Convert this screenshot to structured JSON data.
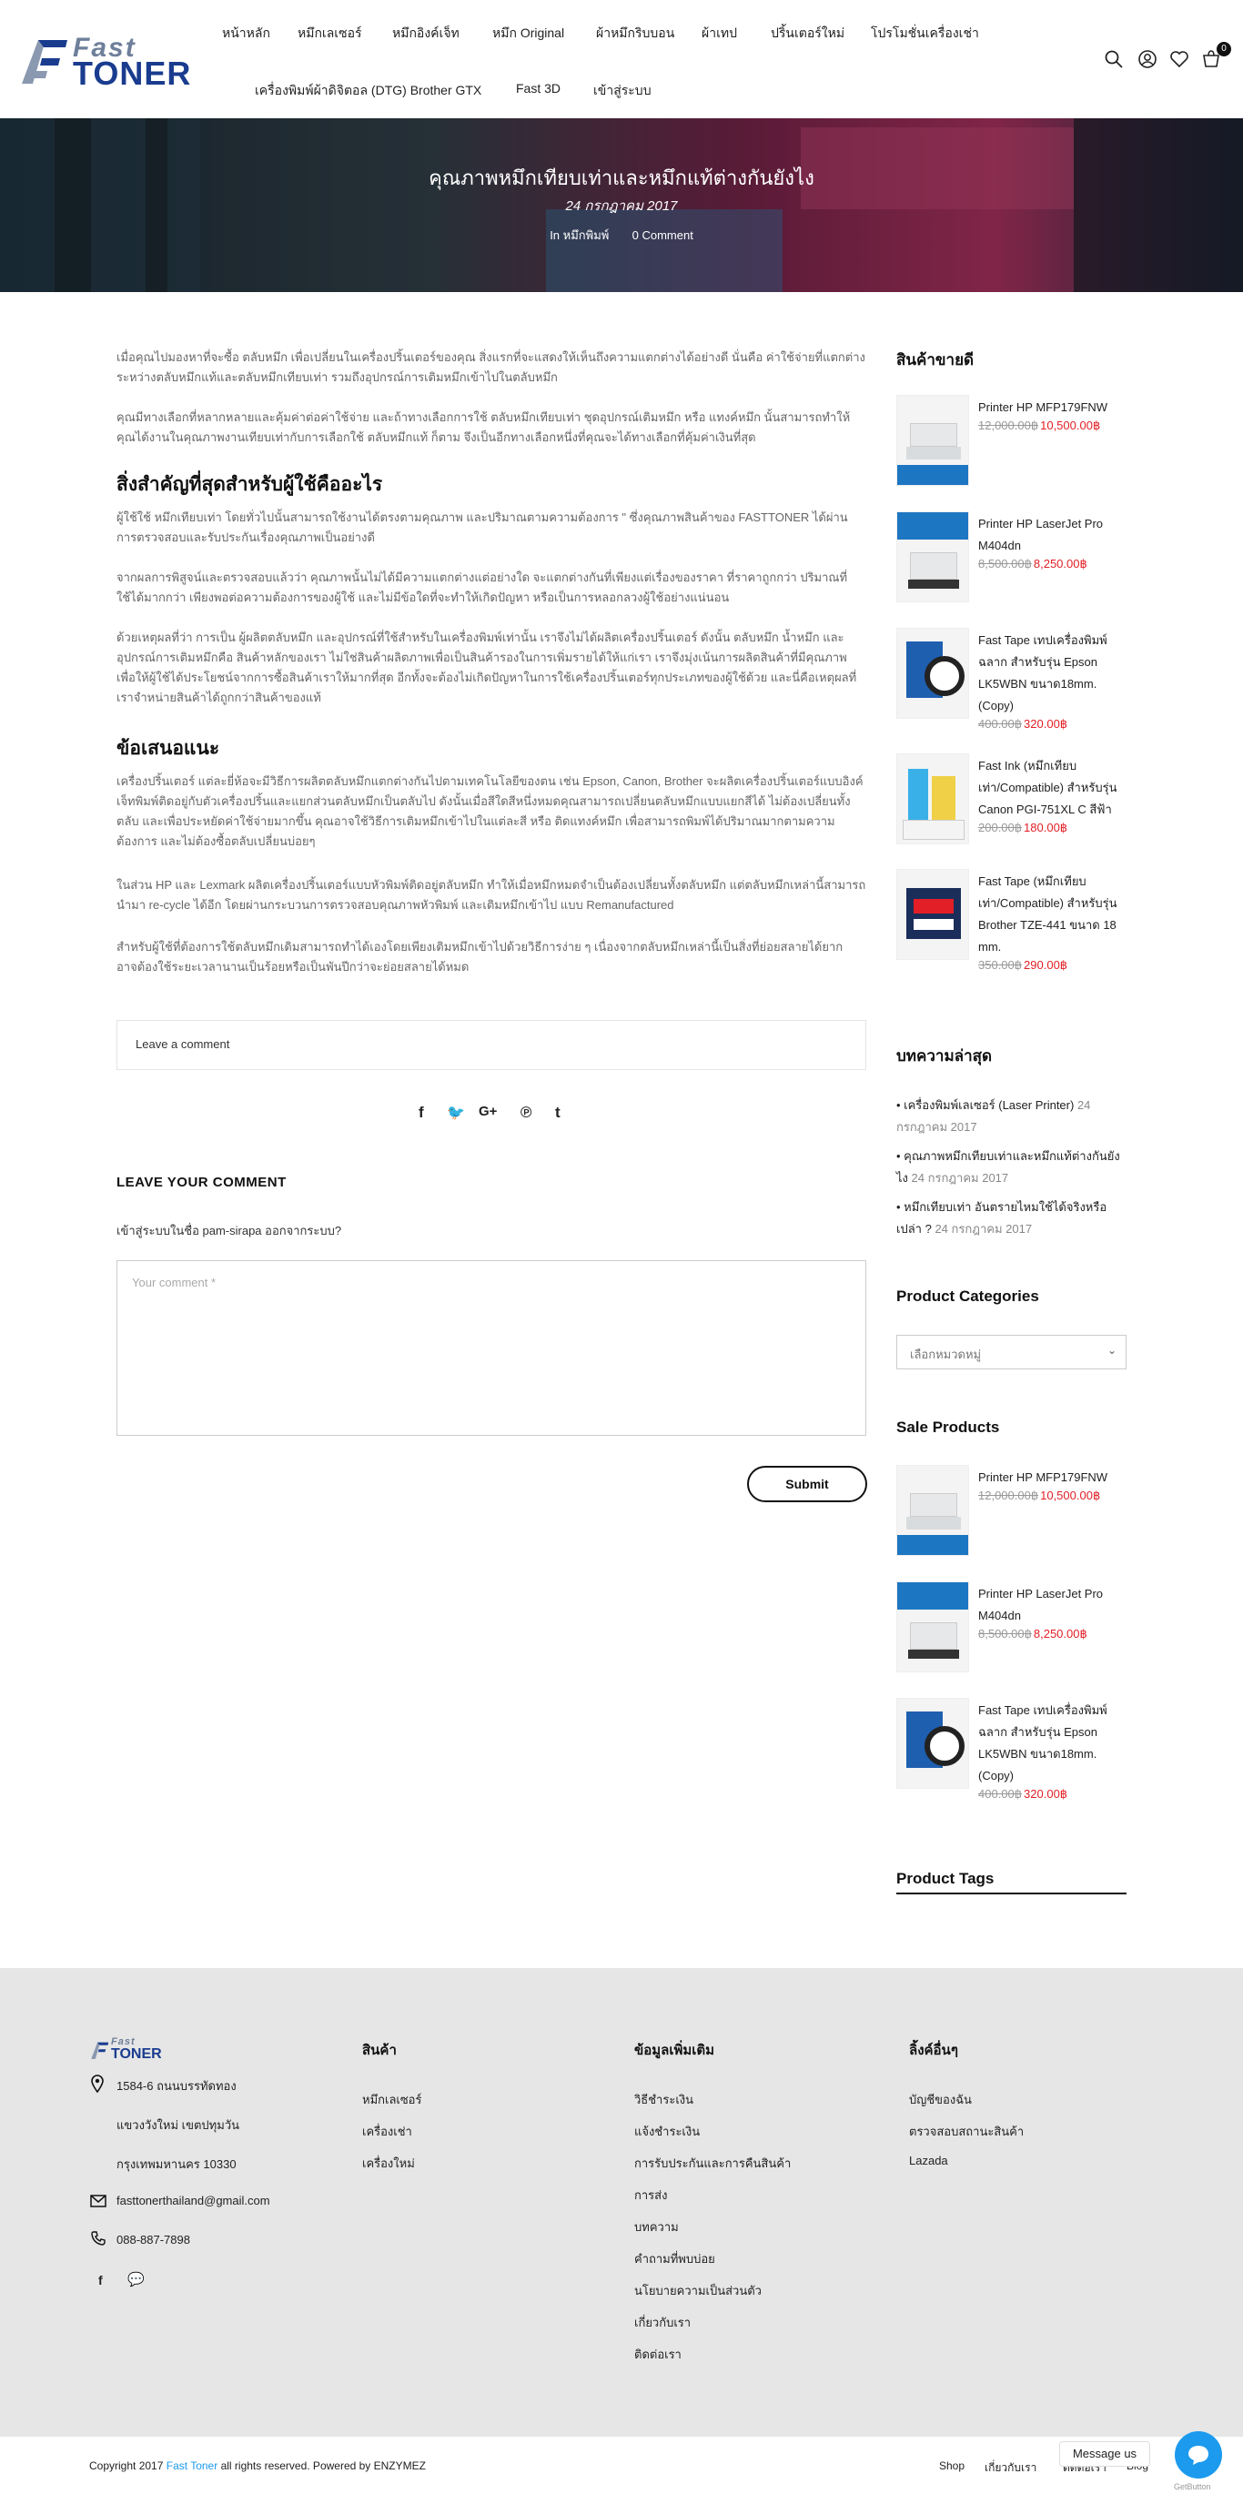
{
  "header": {
    "logo_fast": "Fast",
    "logo_toner": "TONER",
    "nav_row1": [
      "หน้าหลัก",
      "หมึกเลเซอร์",
      "หมึกอิงค์เจ็ท",
      "หมึก Original",
      "ผ้าหมึกริบบอน",
      "ผ้าเทป",
      "ปริ้นเตอร์ใหม่",
      "โปรโมชั่นเครื่องเช่า"
    ],
    "nav_row2": [
      "เครื่องพิมพ์ผ้าดิจิตอล (DTG) Brother GTX",
      "Fast 3D",
      "เข้าสู่ระบบ"
    ],
    "cart_count": "0",
    "icons": [
      "search-icon",
      "user-icon",
      "heart-icon",
      "cart-icon"
    ]
  },
  "banner": {
    "title": "คุณภาพหมึกเทียบเท่าและหมึกแท้ต่างกันยังไง",
    "date": "24 กรกฎาคม 2017",
    "category": "In หมึกพิมพ์",
    "comments": "0 Comment"
  },
  "article": {
    "p1": "เมื่อคุณไปมองหาที่จะซื้อ ตลับหมึก เพื่อเปลี่ยนในเครื่องปริ้นเตอร์ของคุณ สิ่งแรกที่จะแสดงให้เห็นถึงความแตกต่างได้อย่างดี นั่นคือ ค่าใช้จ่ายที่แตกต่างระหว่างตลับหมึกแท้และตลับหมึกเทียบเท่า รวมถึงอุปกรณ์การเติมหมึกเข้าไปในตลับหมึก",
    "p2": "คุณมีทางเลือกที่หลากหลายและคุ้มค่าต่อค่าใช้จ่าย และถ้าทางเลือกการใช้ ตลับหมึกเทียบเท่า ชุดอุปกรณ์เติมหมึก หรือ แทงค์หมึก นั้นสามารถทำให้คุณได้งานในคุณภาพงานเทียบเท่ากับการเลือกใช้ ตลับหมึกแท้ ก็ตาม จึงเป็นอีกทางเลือกหนึ่งที่คุณจะได้ทางเลือกที่คุ้มค่าเงินที่สุด",
    "h1": "สิ่งสำคัญที่สุดสำหรับผู้ใช้คืออะไร",
    "p3": "ผู้ใช้ใช้ หมึกเทียบเท่า โดยทั่วไปนั้นสามารถใช้งานได้ตรงตามคุณภาพ และปริมาณตามความต้องการ \" ซึ่งคุณภาพสินค้าของ FASTTONER ได้ผ่านการตรวจสอบและรับประกันเรื่องคุณภาพเป็นอย่างดี",
    "p4": "จากผลการพิสูจน์และตรวจสอบแล้วว่า คุณภาพนั้นไม่ได้มีความแตกต่างแต่อย่างใด จะแตกต่างกันที่เพียงแต่เรื่องของราคา ที่ราคาถูกกว่า ปริมาณที่ใช้ได้มากกว่า เพียงพอต่อความต้องการของผู้ใช้ และไม่มีข้อใดที่จะทำให้เกิดปัญหา หรือเป็นการหลอกลวงผู้ใช้อย่างแน่นอน",
    "p5": "ด้วยเหตุผลที่ว่า การเป็น ผู้ผลิตตลับหมึก และอุปกรณ์ที่ใช้สำหรับในเครื่องพิมพ์เท่านั้น เราจึงไม่ได้ผลิตเครื่องปริ้นเตอร์ ดังนั้น ตลับหมึก น้ำหมึก และอุปกรณ์การเติมหมึกคือ สินค้าหลักของเรา ไม่ใช่สินค้าผลิตภาพเพื่อเป็นสินค้ารองในการเพิ่มรายได้ให้แก่เรา เราจึงมุ่งเน้นการผลิตสินค้าที่มีคุณภาพ เพื่อให้ผู้ใช้ได้ประโยชน์จากการซื้อสินค้าเราให้มากที่สุด อีกทั้งจะต้องไม่เกิดปัญหาในการใช้เครื่องปริ้นเตอร์ทุกประเภทของผู้ใช้ด้วย และนี่คือเหตุผลที่เราจำหน่ายสินค้าได้ถูกกว่าสินค้าของแท้",
    "h2": "ข้อเสนอแนะ",
    "p6": "เครื่องปริ้นเตอร์ แต่ละยี่ห้อจะมีวิธีการผลิตตลับหมึกแตกต่างกันไปตามเทคโนโลยีของตน เช่น Epson, Canon, Brother จะผลิตเครื่องปริ้นเตอร์แบบอิงค์เจ็ทพิมพ์ติดอยู่กับตัวเครื่องปริ้นและแยกส่วนตลับหมึกเป็นตลับไป ดังนั้นเมื่อสีใดสีหนึ่งหมดคุณสามารถเปลี่ยนตลับหมึกแบบแยกสีได้ ไม่ต้องเปลี่ยนทั้งตลับ และเพื่อประหยัดค่าใช้จ่ายมากขึ้น คุณอาจใช้วิธีการเติมหมึกเข้าไปในแต่ละสี หรือ ติดแทงค์หมึก เพื่อสามารถพิมพ์ได้ปริมาณมากตามความต้องการ และไม่ต้องซื้อตลับเปลี่ยนบ่อยๆ",
    "p7": "ในส่วน HP และ Lexmark ผลิตเครื่องปริ้นเตอร์แบบหัวพิมพ์ติดอยู่ตลับหมึก ทำให้เมื่อหมึกหมดจำเป็นต้องเปลี่ยนทั้งตลับหมึก แต่ตลับหมึกเหล่านี้สามารถนำมา re-cycle ได้อีก โดยผ่านกระบวนการตรวจสอบคุณภาพหัวพิมพ์ และเติมหมึกเข้าไป แบบ Remanufactured",
    "p8": "สำหรับผู้ใช้ที่ต้องการใช้ตลับหมึกเดิมสามารถทำได้เองโดยเพียงเติมหมึกเข้าไปด้วยวิธีการง่าย ๆ เนื่องจากตลับหมึกเหล่านี้เป็นสิ่งที่ย่อยสลายได้ยาก อาจต้องใช้ระยะเวลานานเป็นร้อยหรือเป็นพันปีกว่าจะย่อยสลายได้หมด",
    "leave_comment_tab": "Leave a comment",
    "share_icons": [
      "facebook-icon",
      "twitter-icon",
      "google-plus-icon",
      "pinterest-icon",
      "tumblr-icon"
    ],
    "leave_title": "LEAVE YOUR COMMENT",
    "login_text": "เข้าสู่ระบบในชื่อ pam-sirapa ออกจากระบบ?",
    "comment_placeholder": "Your comment *",
    "submit": "Submit"
  },
  "sidebar": {
    "best_title": "สินค้าขายดี",
    "best": [
      {
        "name": "Printer HP MFP179FNW",
        "old": "12,000.00฿",
        "new": "10,500.00฿"
      },
      {
        "name": "Printer HP LaserJet Pro M404dn",
        "old": "8,500.00฿",
        "new": "8,250.00฿"
      },
      {
        "name": "Fast Tape เทปเครื่องพิมพ์ฉลาก สำหรับรุ่น Epson LK5WBN ขนาด18mm. (Copy)",
        "old": "400.00฿",
        "new": "320.00฿"
      },
      {
        "name": "Fast Ink (หมึกเทียบเท่า/Compatible) สำหรับรุ่น Canon PGI-751XL C สีฟ้า",
        "old": "200.00฿",
        "new": "180.00฿"
      },
      {
        "name": "Fast Tape (หมึกเทียบเท่า/Compatible) สำหรับรุ่น Brother TZE-441 ขนาด 18 mm.",
        "old": "350.00฿",
        "new": "290.00฿"
      }
    ],
    "recent_title": "บทความล่าสุด",
    "recent": [
      {
        "title": "เครื่องพิมพ์เลเซอร์ (Laser Printer)",
        "date": "24 กรกฎาคม 2017"
      },
      {
        "title": "คุณภาพหมึกเทียบเท่าและหมึกแท้ต่างกันยังไง",
        "date": "24 กรกฎาคม 2017"
      },
      {
        "title": "หมึกเทียบเท่า อันตรายไหมใช้ได้จริงหรือเปล่า ?",
        "date": "24 กรกฎาคม 2017"
      }
    ],
    "cat_title": "Product Categories",
    "cat_select": "เลือกหมวดหมู่",
    "sale_title": "Sale Products",
    "sale": [
      {
        "name": "Printer HP MFP179FNW",
        "old": "12,000.00฿",
        "new": "10,500.00฿"
      },
      {
        "name": "Printer HP LaserJet Pro M404dn",
        "old": "8,500.00฿",
        "new": "8,250.00฿"
      },
      {
        "name": "Fast Tape เทปเครื่องพิมพ์ฉลาก สำหรับรุ่น Epson LK5WBN ขนาด18mm. (Copy)",
        "old": "400.00฿",
        "new": "320.00฿"
      }
    ],
    "tags_title": "Product Tags"
  },
  "footer": {
    "logo_fast": "Fast",
    "logo_toner": "TONER",
    "address1": "1584-6 ถนนบรรทัดทอง",
    "address2": "แขวงวังใหม่ เขตปทุมวัน",
    "address3": "กรุงเทพมหานคร 10330",
    "email": "fasttonerthailand@gmail.com",
    "phone": "088-887-7898",
    "col1_title": "สินค้า",
    "col1": [
      "หมึกเลเซอร์",
      "เครื่องเช่า",
      "เครื่องใหม่"
    ],
    "col2_title": "ข้อมูลเพิ่มเติม",
    "col2": [
      "วิธีชำระเงิน",
      "แจ้งชำระเงิน",
      "การรับประกันและการคืนสินค้า",
      "การส่ง",
      "บทความ",
      "คำถามที่พบบ่อย",
      "นโยบายความเป็นส่วนตัว",
      "เกี่ยวกับเรา",
      "ติดต่อเรา"
    ],
    "col3_title": "ลิ้งค์อื่นๆ",
    "col3": [
      "บัญชีของฉัน",
      "ตรวจสอบสถานะสินค้า",
      "Lazada"
    ],
    "copyright_pre": "Copyright 2017",
    "copyright_brand": "Fast Toner",
    "copyright_post": "all rights reserved. Powered by ENZYMEZ",
    "bottom_links": [
      "Shop",
      "เกี่ยวกับเรา",
      "ติดต่อเรา",
      "Blog"
    ],
    "chat_label": "Message us",
    "getbutton": "GetButton"
  },
  "colors": {
    "brand": "#1a3c8f",
    "price": "#e21f26",
    "chat": "#1b9aee"
  }
}
